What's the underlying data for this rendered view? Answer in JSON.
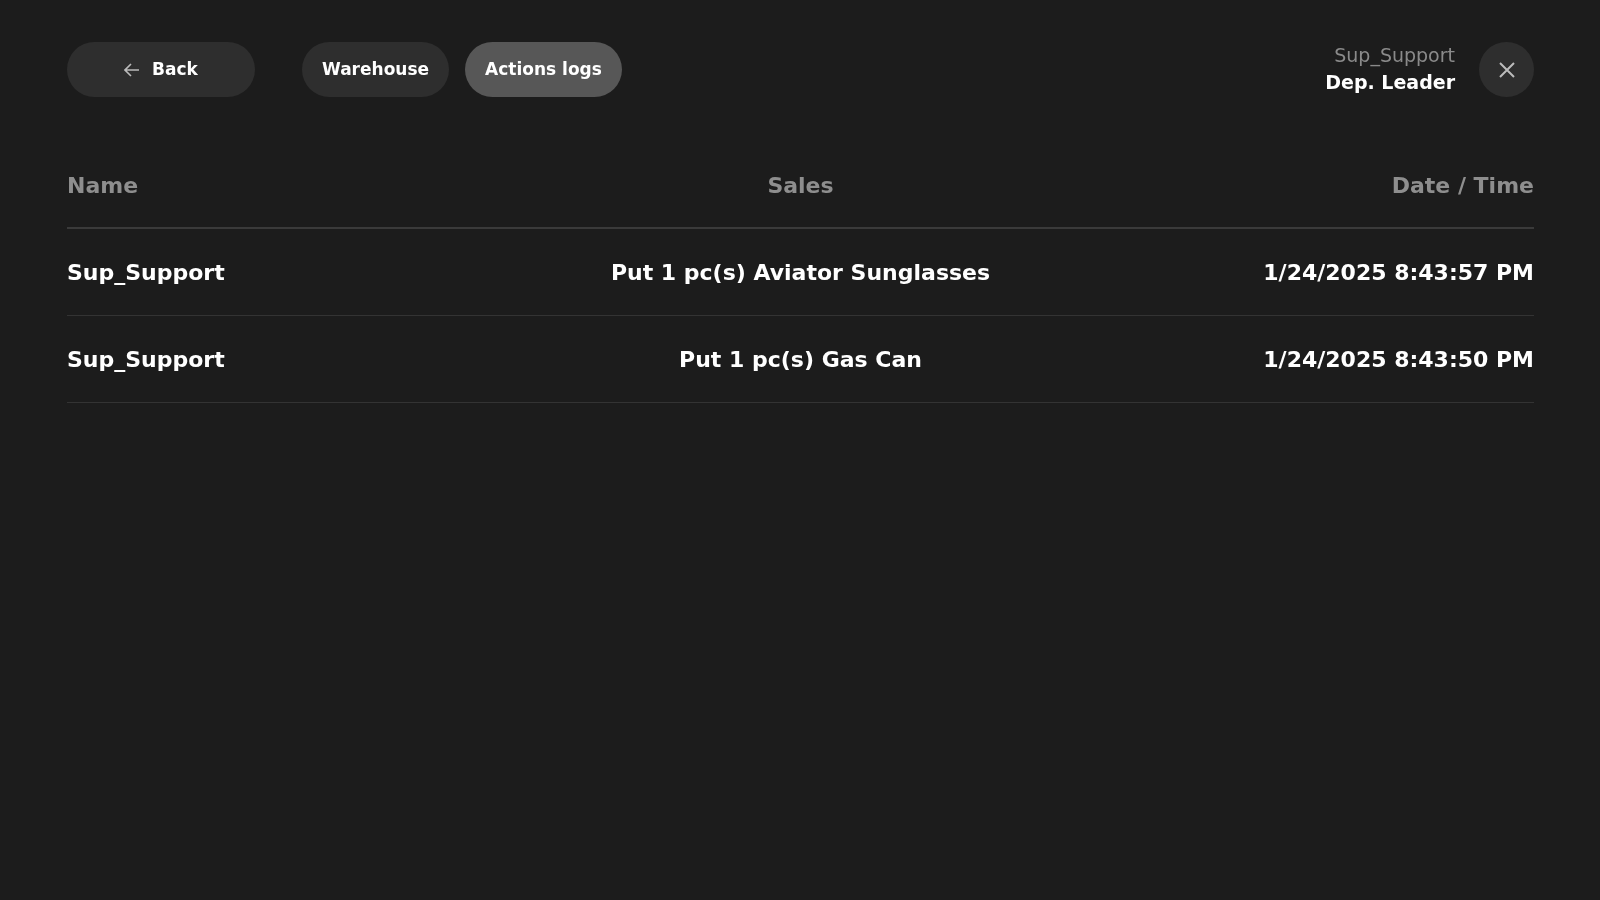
{
  "nav": {
    "back": "Back",
    "tabs": [
      {
        "label": "Warehouse",
        "selected": false
      },
      {
        "label": "Actions logs",
        "selected": true
      }
    ]
  },
  "user": {
    "name": "Sup_Support",
    "role": "Dep. Leader"
  },
  "table": {
    "columns": [
      "Name",
      "Sales",
      "Date / Time"
    ],
    "rows": [
      [
        "Sup_Support",
        "Put 1 pc(s) Aviator Sunglasses",
        "1/24/2025 8:43:57 PM"
      ],
      [
        "Sup_Support",
        "Put 1 pc(s) Gas Can",
        "1/24/2025 8:43:50 PM"
      ]
    ]
  }
}
